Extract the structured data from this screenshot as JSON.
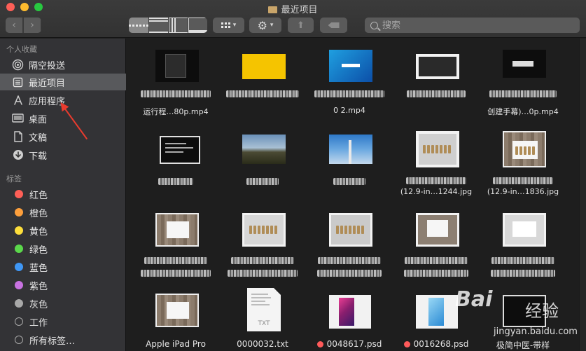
{
  "window": {
    "title": "最近项目"
  },
  "toolbar": {
    "back_icon": "chevron-left-icon",
    "forward_icon": "chevron-right-icon",
    "views": [
      "icon-view",
      "list-view",
      "column-view",
      "gallery-view"
    ],
    "active_view": "icon-view",
    "search_placeholder": "搜索"
  },
  "sidebar": {
    "favorites_title": "个人收藏",
    "favorites": [
      {
        "label": "隔空投送",
        "icon": "airdrop-icon"
      },
      {
        "label": "最近项目",
        "icon": "recents-icon",
        "selected": true
      },
      {
        "label": "应用程序",
        "icon": "applications-icon"
      },
      {
        "label": "桌面",
        "icon": "desktop-icon"
      },
      {
        "label": "文稿",
        "icon": "documents-icon"
      },
      {
        "label": "下载",
        "icon": "downloads-icon"
      }
    ],
    "tags_title": "标签",
    "tags": [
      {
        "label": "红色",
        "color": "#fe5f57"
      },
      {
        "label": "橙色",
        "color": "#fd9f3c"
      },
      {
        "label": "黄色",
        "color": "#fdde3b"
      },
      {
        "label": "绿色",
        "color": "#5bd84b"
      },
      {
        "label": "蓝色",
        "color": "#3f97f5"
      },
      {
        "label": "紫色",
        "color": "#c872e1"
      },
      {
        "label": "灰色",
        "color": "#a8a8a8"
      },
      {
        "label": "工作",
        "color": "ring"
      },
      {
        "label": "所有标签…",
        "color": "ring"
      }
    ]
  },
  "files": {
    "row1": [
      {
        "caption": "运行程…80p.mp4"
      },
      {
        "caption": ""
      },
      {
        "caption": "0 2.mp4"
      },
      {
        "caption": ""
      },
      {
        "caption": "创建手幕)…0p.mp4"
      }
    ],
    "row2": [
      {
        "caption": ""
      },
      {
        "caption": ""
      },
      {
        "caption": ""
      },
      {
        "caption": "(12.9-in…1244.jpg"
      },
      {
        "caption": "(12.9-in…1836.jpg"
      }
    ],
    "row3": [
      {
        "caption": ""
      },
      {
        "caption": ""
      },
      {
        "caption": ""
      },
      {
        "caption": ""
      },
      {
        "caption": ""
      }
    ],
    "row4": [
      {
        "caption": "Apple iPad Pro"
      },
      {
        "caption": "0000032.txt",
        "doc_label": "TXT"
      },
      {
        "caption": "0048617.psd",
        "tag": "red"
      },
      {
        "caption": "0016268.psd",
        "tag": "red"
      },
      {
        "caption": "极简中医-带样"
      }
    ]
  },
  "watermark": {
    "logo": "Bai",
    "cn": "经验",
    "url": "jingyan.baidu.com"
  },
  "colors": {
    "selection": "#58595c",
    "annotation_arrow": "#ea3b2e"
  }
}
